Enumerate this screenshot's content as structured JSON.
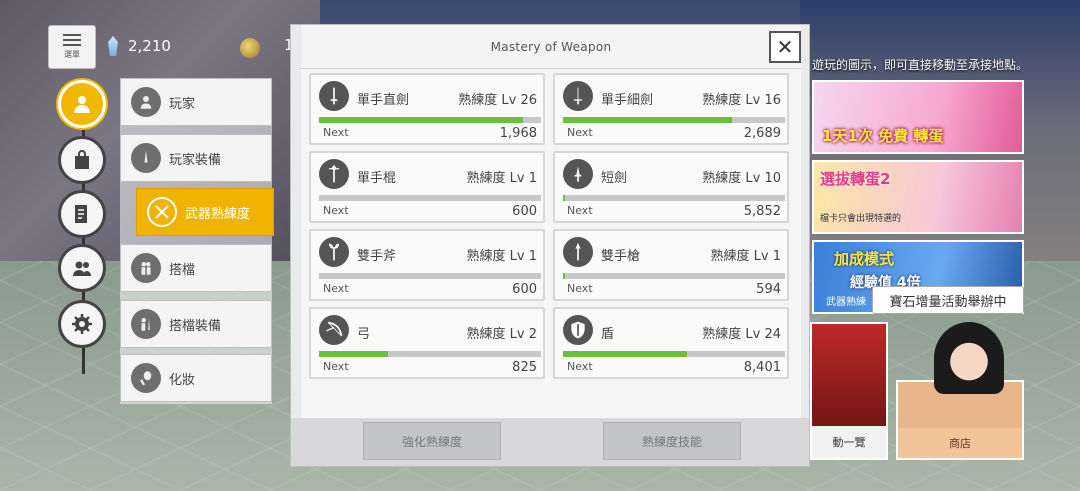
{
  "topbar": {
    "menu_label": "選單",
    "gems": "2,210",
    "coins": "1"
  },
  "side_menu": {
    "items": [
      {
        "label": "玩家",
        "icon": "player-icon"
      },
      {
        "label": "玩家裝備",
        "icon": "equipment-icon"
      },
      {
        "label": "武器熟練度",
        "icon": "crossed-swords-icon",
        "active": true
      },
      {
        "label": "搭檔",
        "icon": "partner-icon"
      },
      {
        "label": "搭檔裝備",
        "icon": "partner-equipment-icon"
      },
      {
        "label": "化妝",
        "icon": "makeup-icon"
      }
    ]
  },
  "nav_circles": [
    {
      "icon": "person-icon",
      "active": true
    },
    {
      "icon": "bag-icon"
    },
    {
      "icon": "notes-icon"
    },
    {
      "icon": "friends-icon"
    },
    {
      "icon": "gear-icon"
    }
  ],
  "dialog": {
    "title": "Mastery of Weapon",
    "close_label": "✕",
    "next_label": "Next",
    "weapons": [
      {
        "name": "單手直劍",
        "level": "熟練度 Lv 26",
        "next": "1,968",
        "progress": 0.92,
        "icon": "straight-sword-icon"
      },
      {
        "name": "單手細劍",
        "level": "熟練度 Lv 16",
        "next": "2,689",
        "progress": 0.76,
        "icon": "rapier-icon"
      },
      {
        "name": "單手棍",
        "level": "熟練度 Lv 1",
        "next": "600",
        "progress": 0.0,
        "icon": "mace-icon"
      },
      {
        "name": "短劍",
        "level": "熟練度 Lv 10",
        "next": "5,852",
        "progress": 0.01,
        "icon": "dagger-icon"
      },
      {
        "name": "雙手斧",
        "level": "熟練度 Lv 1",
        "next": "600",
        "progress": 0.0,
        "icon": "axe-icon"
      },
      {
        "name": "雙手槍",
        "level": "熟練度 Lv 1",
        "next": "594",
        "progress": 0.01,
        "icon": "spear-icon"
      },
      {
        "name": "弓",
        "level": "熟練度 Lv 2",
        "next": "825",
        "progress": 0.31,
        "icon": "bow-icon"
      },
      {
        "name": "盾",
        "level": "熟練度 Lv 24",
        "next": "8,401",
        "progress": 0.56,
        "icon": "shield-icon"
      }
    ],
    "footer": {
      "enhance_label": "強化熟練度",
      "skill_label": "熟練度技能"
    }
  },
  "right_panel": {
    "notice": "遊玩的圖示，即可直接移動至承接地點。",
    "banner1_text": "1天1次 免費 轉蛋",
    "banner2_text": "選拔轉蛋2",
    "banner2_sub": "檔卡只會出現特選的",
    "banner3_text": "加成模式",
    "banner3_text2": "經驗值 4倍",
    "banner3_sub": "武器熟練",
    "event_bubble": "寶石增量活動舉辦中",
    "event_tile_label": "動一覽",
    "shop_label": "商店"
  },
  "colors": {
    "accent": "#f0b400",
    "progress": "#6bbf3a"
  }
}
